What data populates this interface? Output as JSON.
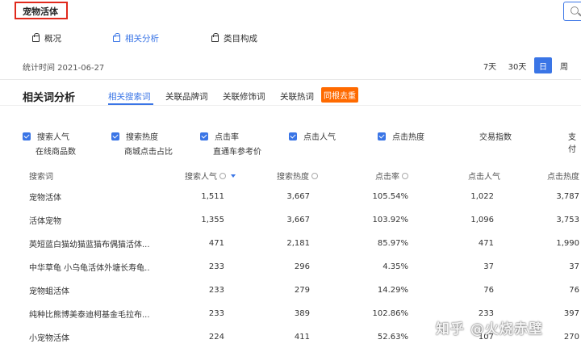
{
  "keyword": "宠物活体",
  "subnav": [
    {
      "label": "概况",
      "active": false
    },
    {
      "label": "相关分析",
      "active": true
    },
    {
      "label": "类目构成",
      "active": false
    }
  ],
  "stat_time": "统计时间 2021-06-27",
  "ranges": [
    {
      "label": "7天",
      "active": false
    },
    {
      "label": "30天",
      "active": false
    },
    {
      "label": "日",
      "active": true
    },
    {
      "label": "周",
      "active": false
    }
  ],
  "section_title": "相关词分析",
  "tabs": [
    {
      "label": "相关搜索词",
      "active": true
    },
    {
      "label": "关联品牌词",
      "active": false
    },
    {
      "label": "关联修饰词",
      "active": false
    },
    {
      "label": "关联热词",
      "active": false
    }
  ],
  "dedupe_button": "同根去重",
  "metrics": [
    {
      "label": "搜索人气",
      "checked": true
    },
    {
      "label": "搜索热度",
      "checked": true
    },
    {
      "label": "点击率",
      "checked": true
    },
    {
      "label": "点击人气",
      "checked": true
    },
    {
      "label": "点击热度",
      "checked": true
    },
    {
      "label": "交易指数",
      "checked": false
    },
    {
      "label": "支付",
      "checked": false
    },
    {
      "label": "在线商品数",
      "checked": false
    },
    {
      "label": "商城点击占比",
      "checked": false
    },
    {
      "label": "直通车参考价",
      "checked": false
    }
  ],
  "table": {
    "headers": [
      "搜索词",
      "搜索人气",
      "搜索热度",
      "点击率",
      "点击人气",
      "点击热度"
    ],
    "rows": [
      [
        "宠物活体",
        "1,511",
        "3,667",
        "105.54%",
        "1,022",
        "3,787"
      ],
      [
        "活体宠物",
        "1,355",
        "3,667",
        "103.92%",
        "1,096",
        "3,753"
      ],
      [
        "英短蓝白猫幼猫蓝猫布偶猫活体...",
        "471",
        "2,181",
        "85.97%",
        "471",
        "1,990"
      ],
      [
        "中华草龟 小乌龟活体外塘长寿龟...",
        "233",
        "296",
        "4.35%",
        "37",
        "37"
      ],
      [
        "宠物蛆活体",
        "233",
        "279",
        "14.29%",
        "76",
        "76"
      ],
      [
        "纯种比熊博美泰迪柯基金毛拉布...",
        "233",
        "389",
        "102.86%",
        "233",
        "397"
      ],
      [
        "小宠物活体",
        "224",
        "411",
        "52.63%",
        "107",
        "270"
      ]
    ]
  },
  "watermark": "知乎 @火烧赤壁"
}
